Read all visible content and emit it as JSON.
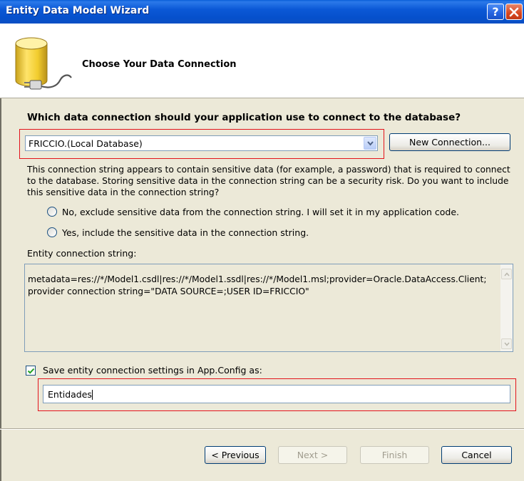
{
  "window": {
    "title": "Entity Data Model Wizard",
    "help_glyph": "?"
  },
  "header": {
    "title": "Choose Your Data Connection",
    "icon": "database-plug-icon"
  },
  "connection": {
    "question": "Which data connection should your application use to connect to the database?",
    "selected": "FRICCIO.(Local Database)",
    "new_button": "New Connection..."
  },
  "sensitive": {
    "info": "This connection string appears to contain sensitive data (for example, a password) that is required to connect to the database. Storing sensitive data in the connection string can be a security risk. Do you want to include this sensitive data in the connection string?",
    "option_no": "No, exclude sensitive data from the connection string. I will set it in my application code.",
    "option_yes": "Yes, include the sensitive data in the connection string."
  },
  "entity_connection": {
    "label": "Entity connection string:",
    "value": "metadata=res://*/Model1.csdl|res://*/Model1.ssdl|res://*/Model1.msl;provider=Oracle.DataAccess.Client;provider connection string=\"DATA SOURCE=;USER ID=FRICCIO\""
  },
  "save": {
    "checked": true,
    "label": "Save entity connection settings in App.Config as:",
    "value": "Entidades"
  },
  "footer": {
    "previous": "< Previous",
    "next": "Next >",
    "finish": "Finish",
    "cancel": "Cancel"
  },
  "colors": {
    "titlebar": "#0a58d6",
    "dialog_bg": "#ece9d8",
    "highlight": "#e3131b"
  }
}
